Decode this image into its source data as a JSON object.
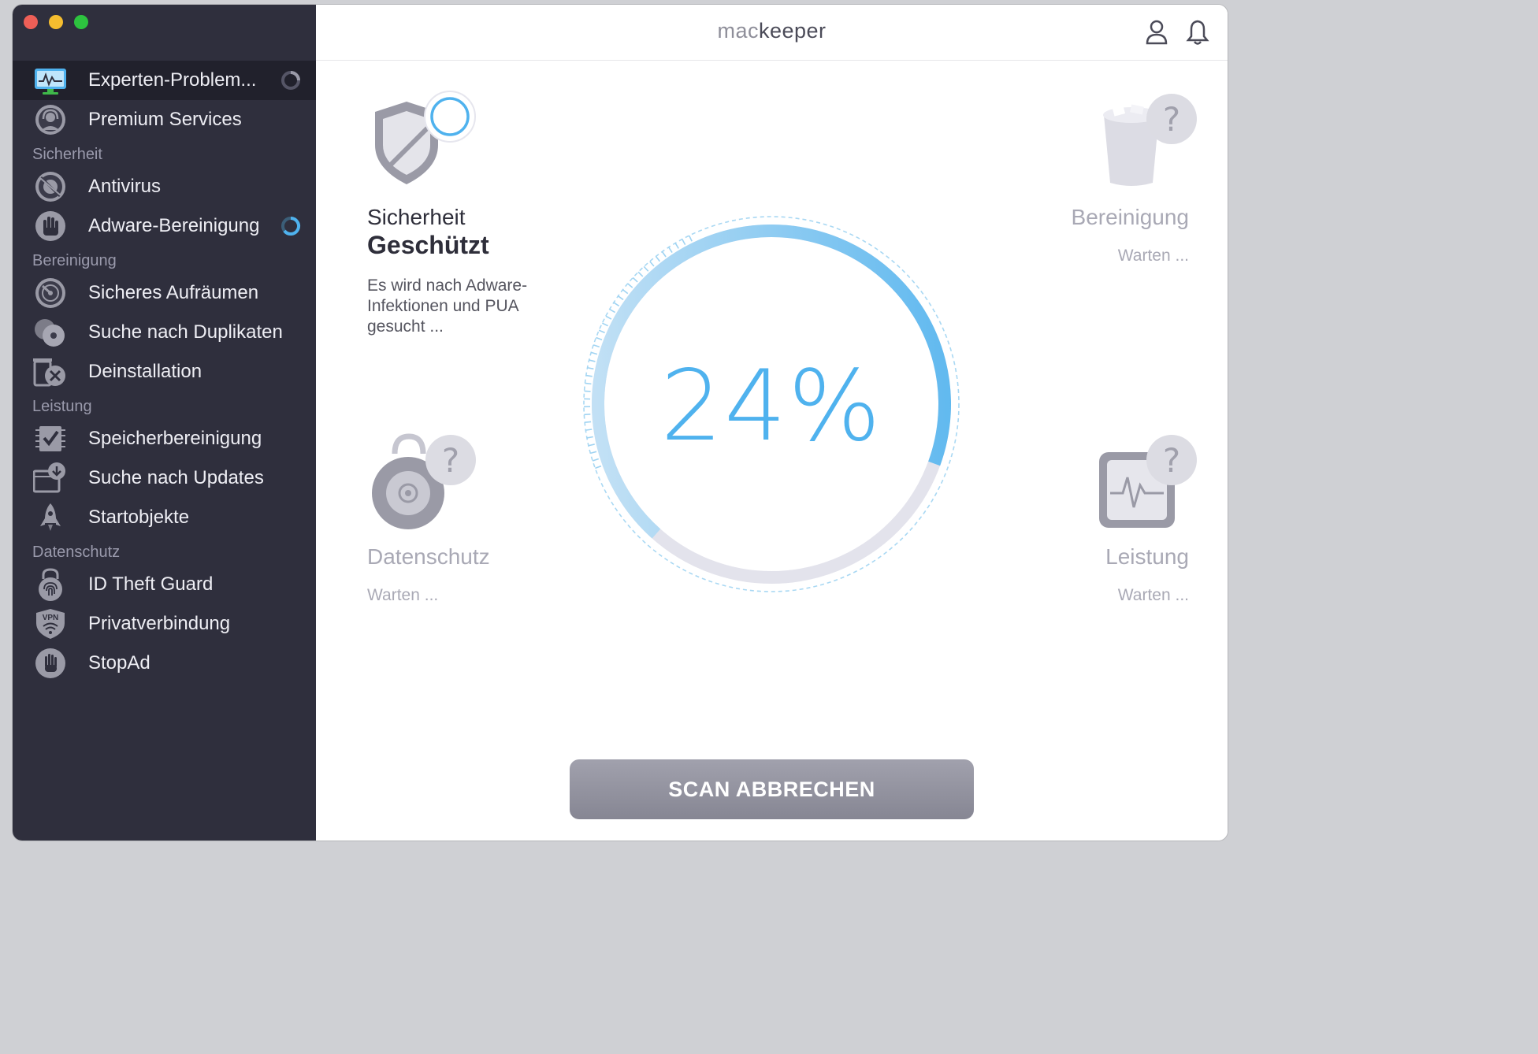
{
  "app": {
    "logo_prefix": "mac",
    "logo_suffix": "keeper"
  },
  "sidebar": {
    "items": [
      {
        "label": "Experten-Problem...",
        "icon": "monitor-icon",
        "selected": true,
        "status": "scanning"
      },
      {
        "label": "Premium Services",
        "icon": "headset-icon"
      },
      {
        "label": "Antivirus",
        "icon": "antivirus-icon"
      },
      {
        "label": "Adware-Bereinigung",
        "icon": "hand-icon",
        "status": "scanning"
      },
      {
        "label": "Sicheres Aufräumen",
        "icon": "broom-disc-icon"
      },
      {
        "label": "Suche nach Duplikaten",
        "icon": "duplicates-icon"
      },
      {
        "label": "Deinstallation",
        "icon": "uninstall-icon"
      },
      {
        "label": "Speicherbereinigung",
        "icon": "memory-chip-icon"
      },
      {
        "label": "Suche nach Updates",
        "icon": "updates-icon"
      },
      {
        "label": "Startobjekte",
        "icon": "rocket-icon"
      },
      {
        "label": "ID Theft Guard",
        "icon": "fingerprint-lock-icon"
      },
      {
        "label": "Privatverbindung",
        "icon": "vpn-shield-icon"
      },
      {
        "label": "StopAd",
        "icon": "stopad-hand-icon"
      }
    ],
    "sections": [
      "Sicherheit",
      "Bereinigung",
      "Leistung",
      "Datenschutz"
    ],
    "vpn_badge": "VPN"
  },
  "cards": {
    "security": {
      "title": "Sicherheit",
      "status": "Geschützt",
      "description": "Es wird nach Adware-Infektionen und PUA gesucht ..."
    },
    "cleaning": {
      "title": "Bereinigung",
      "status": "Warten ..."
    },
    "privacy": {
      "title": "Datenschutz",
      "status": "Warten ..."
    },
    "performance": {
      "title": "Leistung",
      "status": "Warten ..."
    },
    "question_mark": "?"
  },
  "scan": {
    "progress_percent": 24,
    "progress_label": "24%",
    "cancel_button": "SCAN ABBRECHEN"
  },
  "colors": {
    "sidebar_bg": "#2f2f3d",
    "accent": "#4fb2ee",
    "button": "#8e8e9b"
  }
}
